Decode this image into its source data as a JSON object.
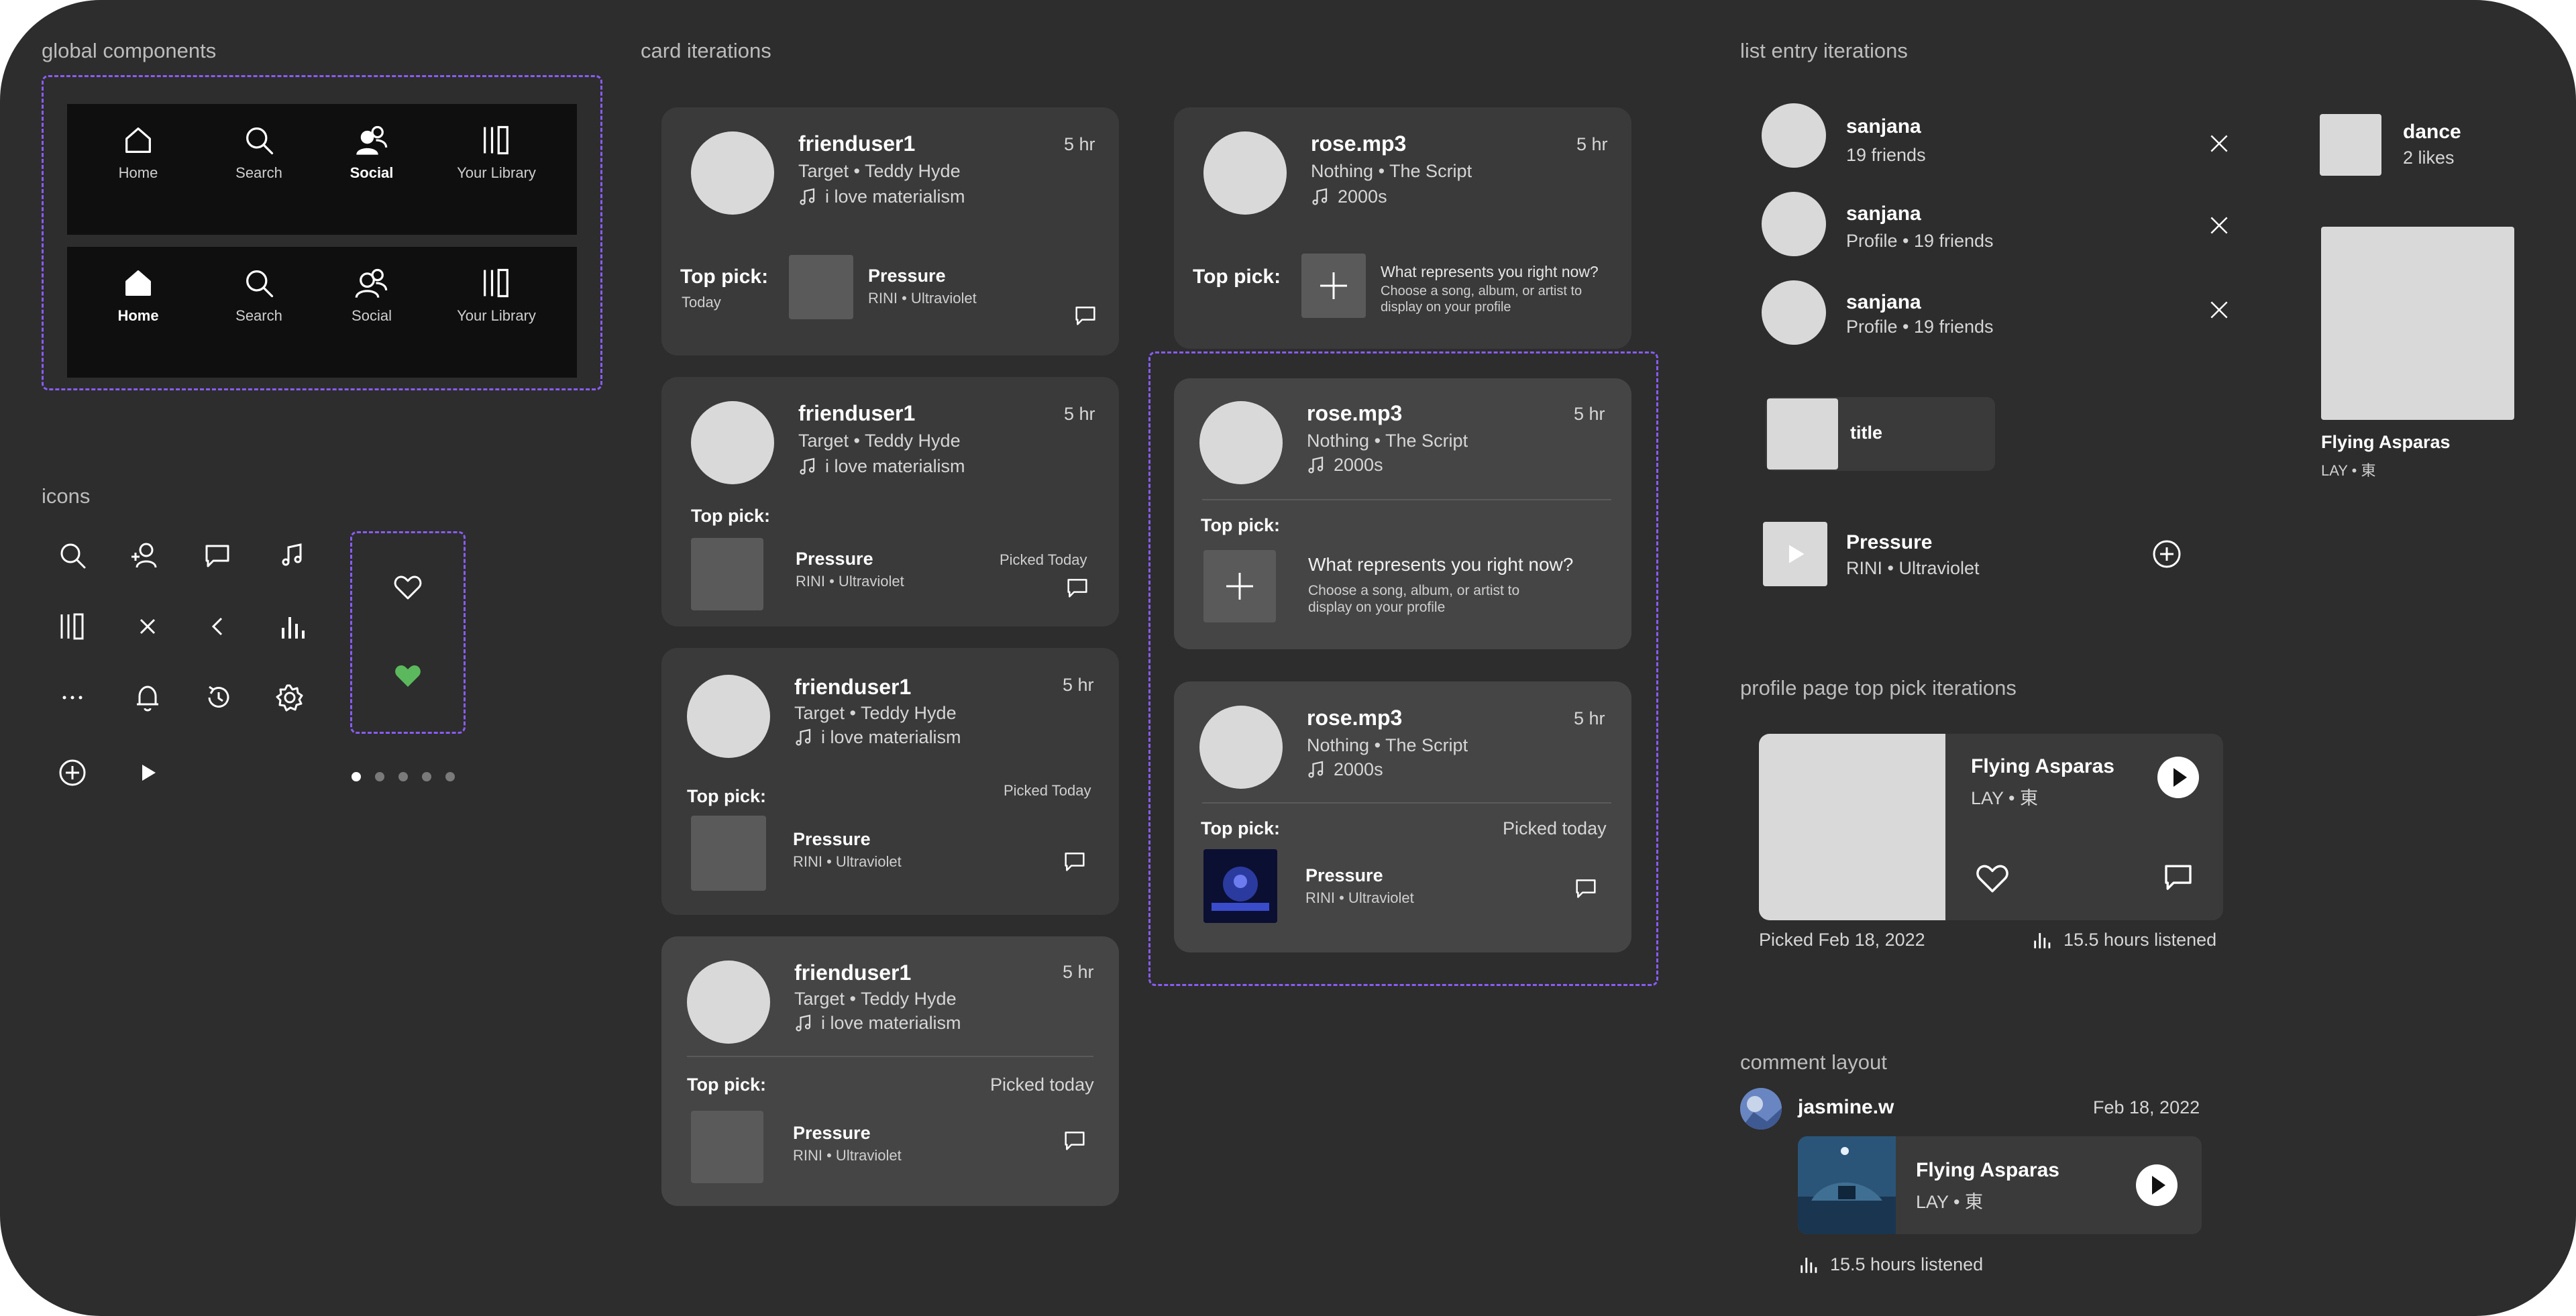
{
  "sections": {
    "global_components": "global components",
    "icons": "icons",
    "card_iterations": "card iterations",
    "list_entry_iterations": "list entry iterations",
    "profile_top_pick": "profile page top pick iterations",
    "comment_layout": "comment layout"
  },
  "nav": {
    "items": [
      "Home",
      "Search",
      "Social",
      "Your Library"
    ],
    "bar1_active": "Social",
    "bar2_active": "Home"
  },
  "icons_grid": [
    "search-icon",
    "add-friend-icon",
    "comment-icon",
    "music-note-icon",
    "library-icon",
    "close-icon",
    "back-icon",
    "stats-icon",
    "more-icon",
    "bell-icon",
    "history-icon",
    "settings-icon",
    "add-circle-icon",
    "play-icon"
  ],
  "heart_colors": {
    "outline": "#ffffff",
    "filled": "#5cb85c"
  },
  "accent": "#8a5cf6",
  "pagination_dots": 5,
  "cards_left": [
    {
      "user": "frienduser1",
      "time": "5 hr",
      "track": "Target • Teddy Hyde",
      "status": "i love materialism",
      "top_pick_label": "Top pick:",
      "top_pick_sub": "Today",
      "song": "Pressure",
      "artist": "RINI • Ultraviolet",
      "picked": ""
    },
    {
      "user": "frienduser1",
      "time": "5 hr",
      "track": "Target • Teddy Hyde",
      "status": "i love materialism",
      "top_pick_label": "Top pick:",
      "top_pick_sub": "",
      "song": "Pressure",
      "artist": "RINI • Ultraviolet",
      "picked": "Picked Today"
    },
    {
      "user": "frienduser1",
      "time": "5 hr",
      "track": "Target • Teddy Hyde",
      "status": "i love materialism",
      "top_pick_label": "Top pick:",
      "top_pick_sub": "",
      "song": "Pressure",
      "artist": "RINI • Ultraviolet",
      "picked": "Picked Today"
    },
    {
      "user": "frienduser1",
      "time": "5 hr",
      "track": "Target • Teddy Hyde",
      "status": "i love materialism",
      "top_pick_label": "Top pick:",
      "top_pick_sub": "",
      "song": "Pressure",
      "artist": "RINI • Ultraviolet",
      "picked": "Picked today"
    }
  ],
  "cards_right": [
    {
      "user": "rose.mp3",
      "time": "5 hr",
      "track": "Nothing • The Script",
      "status": "2000s",
      "top_pick_label": "Top pick:",
      "prompt": "What represents you right now?",
      "prompt_sub": "Choose a song, album, or artist to display on your profile"
    },
    {
      "user": "rose.mp3",
      "time": "5 hr",
      "track": "Nothing • The Script",
      "status": "2000s",
      "top_pick_label": "Top pick:",
      "prompt": "What represents you right now?",
      "prompt_sub": "Choose a song, album, or artist to display on your profile"
    },
    {
      "user": "rose.mp3",
      "time": "5 hr",
      "track": "Nothing • The Script",
      "status": "2000s",
      "top_pick_label": "Top pick:",
      "picked": "Picked today",
      "song": "Pressure",
      "artist": "RINI • Ultraviolet"
    }
  ],
  "list_entries": [
    {
      "name": "sanjana",
      "sub": "19 friends"
    },
    {
      "name": "sanjana",
      "sub": "Profile • 19 friends"
    },
    {
      "name": "sanjana",
      "sub": "Profile • 19 friends"
    }
  ],
  "title_entry": "title",
  "track_entry": {
    "song": "Pressure",
    "artist": "RINI • Ultraviolet"
  },
  "dance_entry": {
    "name": "dance",
    "sub": "2 likes"
  },
  "album_tile": {
    "name": "Flying Asparas",
    "sub": "LAY • 東"
  },
  "top_pick": {
    "song": "Flying Asparas",
    "artist": "LAY • 東",
    "picked": "Picked Feb 18, 2022",
    "listened": "15.5 hours listened"
  },
  "comment": {
    "user": "jasmine.w",
    "date": "Feb 18, 2022",
    "song": "Flying Asparas",
    "artist": "LAY • 東",
    "listened": "15.5 hours listened"
  }
}
